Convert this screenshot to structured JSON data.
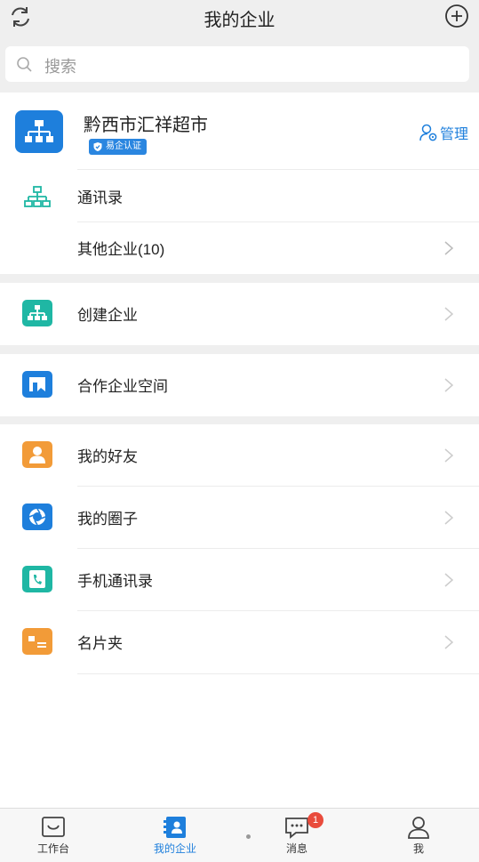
{
  "header": {
    "title": "我的企业"
  },
  "search": {
    "placeholder": "搜索"
  },
  "company": {
    "name": "黔西市汇祥超市",
    "badge": "易企认证",
    "manage_label": "管理",
    "rows": [
      {
        "label": "通讯录"
      },
      {
        "label": "其他企业(10)"
      }
    ]
  },
  "create": {
    "label": "创建企业"
  },
  "partner": {
    "label": "合作企业空间"
  },
  "social": {
    "rows": [
      {
        "label": "我的好友",
        "icon": "friend-icon",
        "color": "#f29b38"
      },
      {
        "label": "我的圈子",
        "icon": "circle-icon",
        "color": "#1e7fdc"
      },
      {
        "label": "手机通讯录",
        "icon": "phone-contacts-icon",
        "color": "#1fb7a4"
      },
      {
        "label": "名片夹",
        "icon": "card-holder-icon",
        "color": "#f29b38"
      }
    ]
  },
  "colors": {
    "accent": "#1e7fdc",
    "teal": "#1fb7a4",
    "orange": "#f29b38",
    "badge_red": "#e94b3c"
  },
  "tabbar": {
    "tabs": [
      {
        "label": "工作台"
      },
      {
        "label": "我的企业"
      },
      {
        "label": "消息",
        "badge": "1"
      },
      {
        "label": "我"
      }
    ]
  }
}
